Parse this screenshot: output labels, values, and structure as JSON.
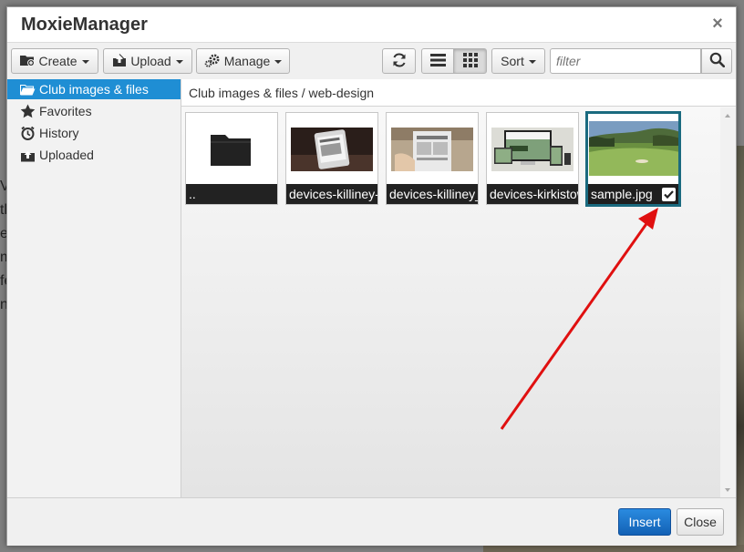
{
  "dialog": {
    "title": "MoxieManager",
    "close_symbol": "×"
  },
  "background": {
    "side_letters": [
      "V",
      "th",
      "e",
      "m",
      "fe",
      "n"
    ]
  },
  "toolbar": {
    "create_label": "Create",
    "upload_label": "Upload",
    "manage_label": "Manage",
    "sort_label": "Sort",
    "filter_placeholder": "filter",
    "refresh_icon": "refresh-icon",
    "list_view_icon": "list-view-icon",
    "thumbnail_view_icon": "grid-view-icon",
    "active_view": "thumbnails"
  },
  "sidebar": {
    "items": [
      {
        "label": "Club images & files",
        "icon": "folder-open-icon",
        "selected": true
      },
      {
        "label": "Favorites",
        "icon": "star-icon",
        "selected": false
      },
      {
        "label": "History",
        "icon": "clock-icon",
        "selected": false
      },
      {
        "label": "Uploaded",
        "icon": "upload-icon",
        "selected": false
      }
    ]
  },
  "breadcrumb": "Club images & files / web-design",
  "files": [
    {
      "name": "..",
      "type": "parent-folder",
      "selected": false
    },
    {
      "name": "devices-killiney-",
      "type": "image",
      "selected": false
    },
    {
      "name": "devices-killiney_",
      "type": "image",
      "selected": false
    },
    {
      "name": "devices-kirkistow",
      "type": "image",
      "selected": false
    },
    {
      "name": "sample.jpg",
      "type": "image",
      "selected": true
    }
  ],
  "footer": {
    "insert_label": "Insert",
    "close_label": "Close"
  },
  "colors": {
    "accent": "#1f8ed4",
    "selected_border": "#1a6a7f",
    "insert_button": "#1b71c8",
    "annotation_arrow": "#e01010"
  }
}
